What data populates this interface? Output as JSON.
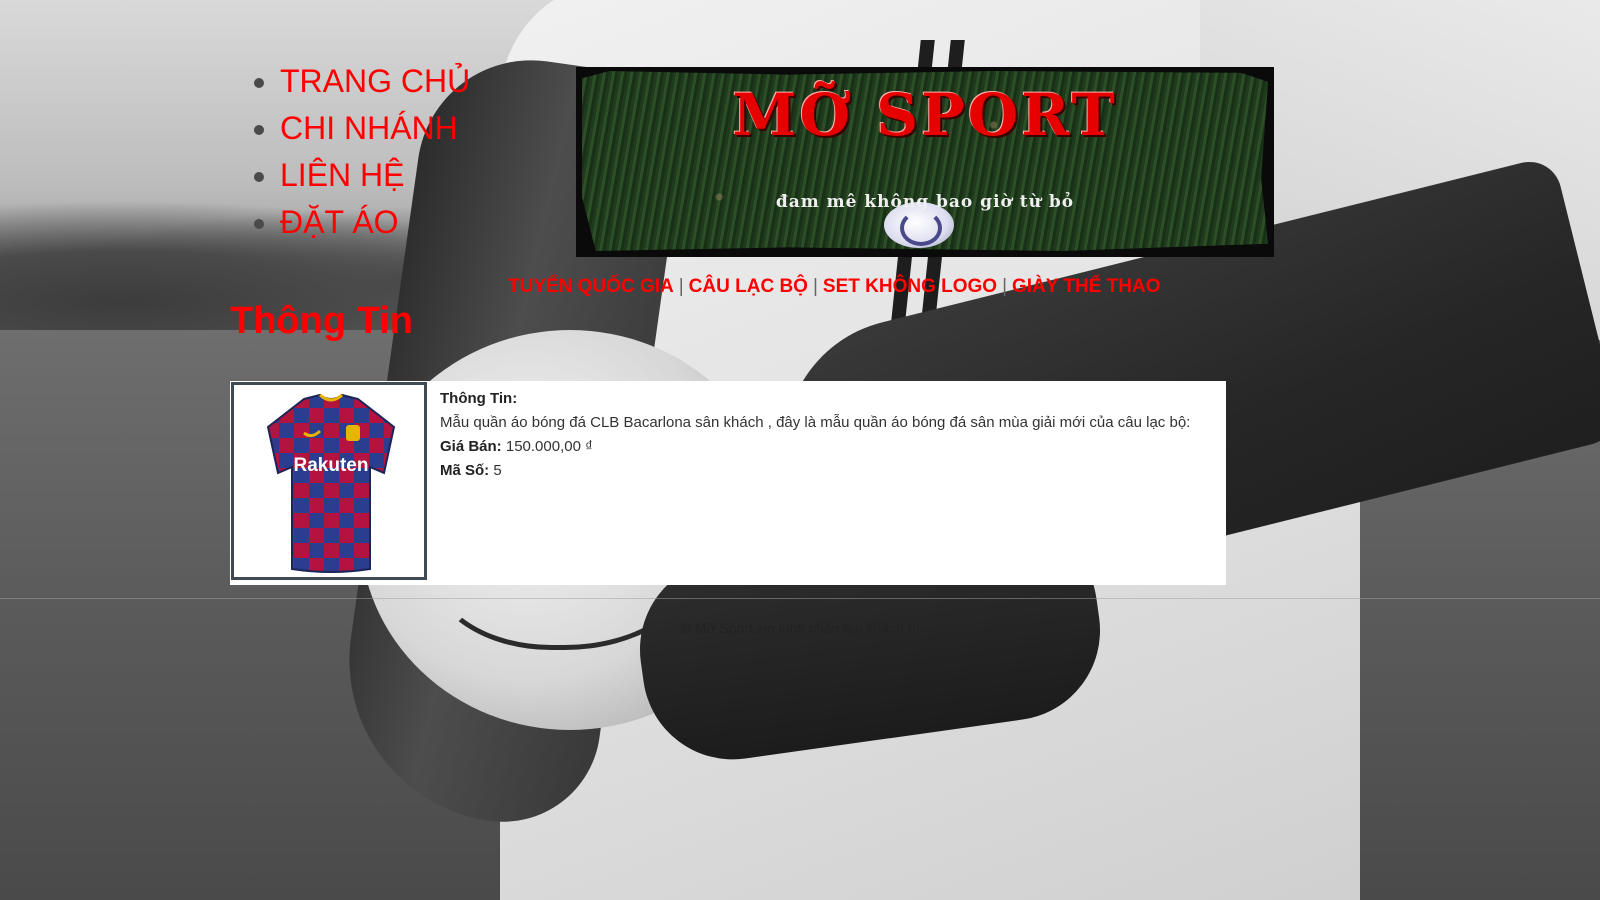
{
  "main_nav": {
    "items": [
      {
        "label": "TRANG CHỦ"
      },
      {
        "label": "CHI NHÁNH"
      },
      {
        "label": "LIÊN HỆ"
      },
      {
        "label": "ĐẶT ÁO"
      }
    ]
  },
  "banner": {
    "title": "MỠ SPORT",
    "slogan": "đam mê không bao giờ từ bỏ"
  },
  "category_nav": {
    "items": [
      {
        "label": "TUYỂN QUỐC GIA"
      },
      {
        "label": "CÂU LẠC BỘ"
      },
      {
        "label": "SET KHÔNG LOGO"
      },
      {
        "label": "GIÀY THỂ THAO"
      }
    ],
    "separator": "|"
  },
  "section": {
    "title": "Thông Tin"
  },
  "product": {
    "info_label": "Thông Tin:",
    "description": "Mẫu quần áo bóng đá CLB Bacarlona sân khách , đây là mẫu quần áo bóng đá sân mùa giải mới của câu lạc bộ:",
    "price_label": "Giá Bán:",
    "price_value": "150.000,00 ₫",
    "code_label": "Mã Số:",
    "code_value": "5",
    "jersey_sponsor": "Rakuten",
    "jersey_colors": {
      "blue": "#2a3d8f",
      "red": "#b3143f",
      "gold": "#e8b400"
    }
  },
  "footer": {
    "text": "© Mỡ Sport xin kính chào quí khách !!!"
  },
  "colors": {
    "link": "#ff0000",
    "card_bg": "#ffffff"
  }
}
